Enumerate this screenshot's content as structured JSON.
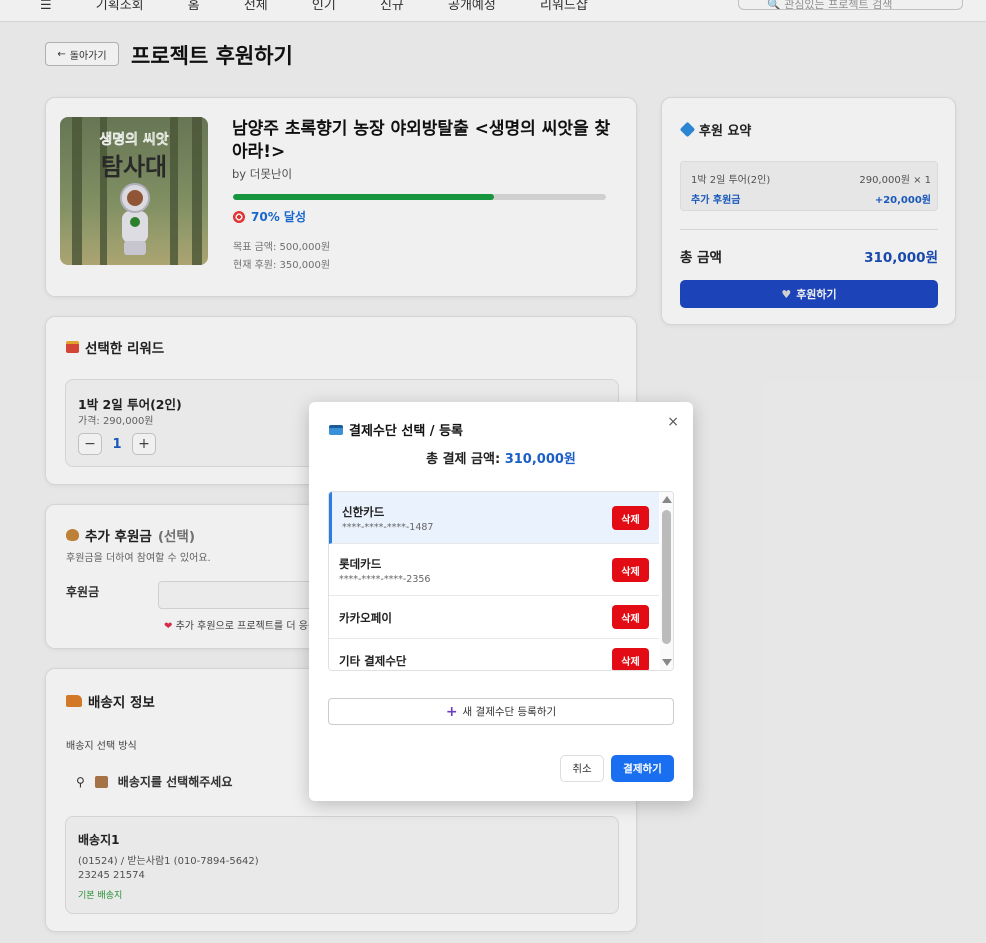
{
  "topbar": {
    "nav": "☰ 기획조회  홈  전체  인기  신규  공개예정  리워드샵",
    "search_placeholder": "🔍 관심있는 프로젝트 검색"
  },
  "header": {
    "back_label": "돌아가기",
    "title": "프로젝트 후원하기"
  },
  "project": {
    "image_title_top": "생명의 씨앗",
    "image_title_main": "탐사대",
    "title": "남양주 초록향기 농장 야외방탈출 <생명의 씨앗을 찾아라!>",
    "author": "by 더못난이",
    "progress_pct": 70,
    "achieve": "70% 달성",
    "goal": "목표 금액: 500,000원",
    "current": "현재 후원: 350,000원"
  },
  "reward": {
    "section_title": "선택한 리워드",
    "name": "1박 2일 투어(2인)",
    "price": "가격: 290,000원",
    "minus": "−",
    "qty": "1",
    "plus": "+"
  },
  "extra": {
    "title": "추가 후원금",
    "title_suffix": "(선택)",
    "desc": "후원금을 더하여 참여할 수 있어요.",
    "label": "후원금",
    "note": "추가 후원으로 프로젝트를 더 응원해주세요!"
  },
  "shipping": {
    "title": "배송지 정보",
    "method_label": "배송지 선택 방식",
    "select_text": "배송지를 선택해주세요",
    "address": {
      "name": "배송지1",
      "line1": "(01524) / 받는사람1 (010-7894-5642)",
      "line2": "23245 21574",
      "default_tag": "기본 배송지"
    }
  },
  "summary": {
    "title": "후원 요약",
    "item_name": "1박 2일 투어(2인)",
    "item_price": "290,000원 × 1",
    "extra_label": "추가 후원금",
    "extra_value": "+20,000원",
    "total_label": "총 금액",
    "total_value": "310,000원",
    "button_label": "후원하기"
  },
  "modal": {
    "title": "결제수단 선택 / 등록",
    "close": "×",
    "total_label": "총 결제 금액:",
    "total_value": "310,000원",
    "methods": [
      {
        "name": "신한카드",
        "number": "****-****-****-1487",
        "delete": "삭제"
      },
      {
        "name": "롯데카드",
        "number": "****-****-****-2356",
        "delete": "삭제"
      },
      {
        "name": "카카오페이",
        "number": "",
        "delete": "삭제"
      },
      {
        "name": "기타 결제수단",
        "number": "",
        "delete": "삭제"
      }
    ],
    "add_label": "새 결제수단 등록하기",
    "cancel_label": "취소",
    "pay_label": "결제하기"
  },
  "colors": {
    "primary": "#1a6ef0",
    "summary_button": "#1e48c4",
    "progress": "#199f43",
    "delete": "#e30c14",
    "selected_bg": "#eaf3fd"
  }
}
